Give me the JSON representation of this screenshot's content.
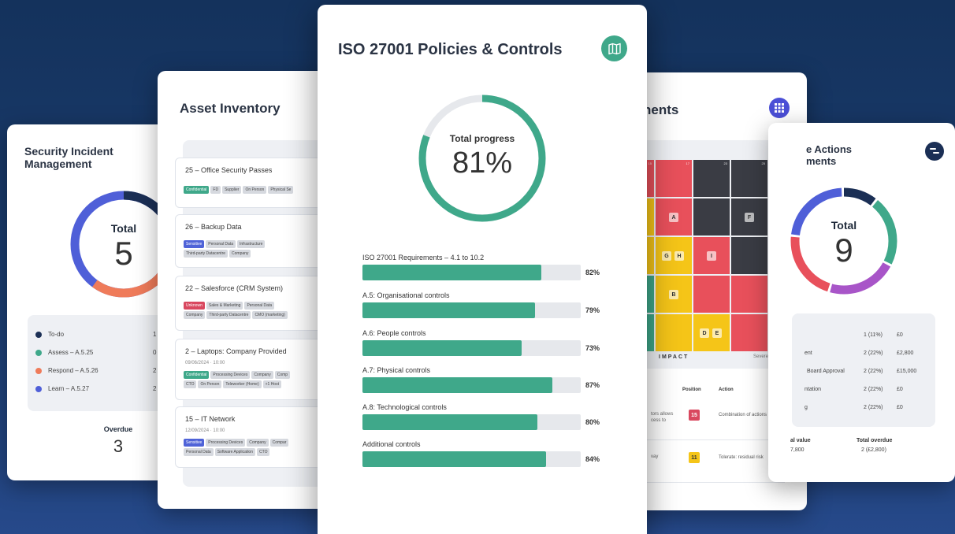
{
  "security_incident": {
    "title": "Security Incident Management",
    "total_label": "Total",
    "total_value": "5",
    "legend": [
      {
        "label": "To-do",
        "count": "1",
        "color": "#1b2f55"
      },
      {
        "label": "Assess – A.5.25",
        "count": "0",
        "color": "#3fa88a"
      },
      {
        "label": "Respond – A.5.26",
        "count": "2",
        "color": "#ef7b5a"
      },
      {
        "label": "Learn – A.5.27",
        "count": "2",
        "color": "#4f5fd8"
      }
    ],
    "overdue_label": "Overdue",
    "overdue_value": "3"
  },
  "asset_inventory": {
    "title": "Asset Inventory",
    "items": [
      {
        "name": "25 – Office Security Passes",
        "date": "",
        "tags": [
          [
            "Confidential",
            "green"
          ],
          [
            "FD",
            ""
          ],
          [
            "Supplier",
            ""
          ],
          [
            "On Person",
            ""
          ],
          [
            "Physical Se",
            ""
          ]
        ]
      },
      {
        "name": "26 – Backup Data",
        "date": "",
        "tags": [
          [
            "Sensitive",
            "blue"
          ],
          [
            "Personal Data",
            ""
          ],
          [
            "Infrastructure",
            ""
          ]
        ],
        "tags2": [
          [
            "Third-party Datacentre",
            ""
          ],
          [
            "Company",
            ""
          ]
        ]
      },
      {
        "name": "22 – Salesforce (CRM System)",
        "date": "",
        "tags": [
          [
            "Unknown",
            "red"
          ],
          [
            "Sales & Marketing",
            ""
          ],
          [
            "Personal Data",
            ""
          ]
        ],
        "tags2": [
          [
            "Company",
            ""
          ],
          [
            "Third-party Datacentre",
            ""
          ],
          [
            "CMO (marketing)",
            ""
          ]
        ]
      },
      {
        "name": "2 – Laptops: Company Provided",
        "date": "09/06/2024 · 10:00",
        "tags": [
          [
            "Confidential",
            "green"
          ],
          [
            "Processing Devices",
            ""
          ],
          [
            "Company",
            ""
          ],
          [
            "Comp",
            ""
          ]
        ],
        "tags2": [
          [
            "CTO",
            ""
          ],
          [
            "On Person",
            ""
          ],
          [
            "Teleworker (Home)",
            ""
          ],
          [
            "+1 Host",
            ""
          ]
        ]
      },
      {
        "name": "15 – IT Network",
        "date": "12/09/2024 · 10:00",
        "tags": [
          [
            "Sensitive",
            "blue"
          ],
          [
            "Processing Devices",
            ""
          ],
          [
            "Company",
            ""
          ],
          [
            "Compar",
            ""
          ]
        ],
        "tags2": [
          [
            "Personal Data",
            ""
          ],
          [
            "Software Application",
            ""
          ],
          [
            "CTO",
            ""
          ]
        ]
      }
    ]
  },
  "iso": {
    "title": "ISO 27001 Policies & Controls",
    "icon": "map-icon",
    "progress_label": "Total progress",
    "progress_value": "81%",
    "progress_fraction": 0.81,
    "accent": "#3fa88a",
    "bars": [
      {
        "label": "ISO 27001 Requirements – 4.1 to 10.2",
        "pct": 82,
        "pct_text": "82%"
      },
      {
        "label": "A.5: Organisational controls",
        "pct": 79,
        "pct_text": "79%"
      },
      {
        "label": "A.6: People controls",
        "pct": 73,
        "pct_text": "73%"
      },
      {
        "label": "A.7: Physical controls",
        "pct": 87,
        "pct_text": "87%"
      },
      {
        "label": "A.8: Technological controls",
        "pct": 80,
        "pct_text": "80%"
      },
      {
        "label": "Additional controls",
        "pct": 84,
        "pct_text": "84%"
      }
    ]
  },
  "risk": {
    "title_visible": "nents",
    "icon": "grid-icon",
    "impact_label": "IMPACT",
    "severe_label": "Severe",
    "header_position": "Position",
    "header_action": "Action",
    "rows": [
      {
        "desc": "tors allows\ncess to",
        "position": "15",
        "badge_color": "#d9485f",
        "badge_text_color": "#ffffff",
        "action": "Combination of actions"
      },
      {
        "desc": "vay",
        "position": "11",
        "badge_color": "#f5c518",
        "badge_text_color": "#333333",
        "action": "Tolerate: residual risk"
      }
    ],
    "cells": [
      {
        "col": 0,
        "row": 0,
        "color": "#e8505b",
        "num": "15"
      },
      {
        "col": 1,
        "row": 0,
        "color": "#e8505b",
        "num": "17"
      },
      {
        "col": 2,
        "row": 0,
        "color": "#3a3c44",
        "num": "23"
      },
      {
        "col": 3,
        "row": 0,
        "color": "#3a3c44",
        "num": "25"
      },
      {
        "col": 0,
        "row": 1,
        "color": "#f5c518",
        "num": ""
      },
      {
        "col": 1,
        "row": 1,
        "color": "#e8505b",
        "num": "",
        "letter": "A"
      },
      {
        "col": 2,
        "row": 1,
        "color": "#3a3c44",
        "num": ""
      },
      {
        "col": 3,
        "row": 1,
        "color": "#3a3c44",
        "num": "",
        "letter": "F"
      },
      {
        "col": 0,
        "row": 2,
        "color": "#f5c518",
        "num": ""
      },
      {
        "col": 1,
        "row": 2,
        "color": "#f5c518",
        "num": "",
        "letter": "G",
        "letter2": "H"
      },
      {
        "col": 2,
        "row": 2,
        "color": "#e8505b",
        "num": "",
        "letter": "I"
      },
      {
        "col": 3,
        "row": 2,
        "color": "#3a3c44",
        "num": ""
      },
      {
        "col": 0,
        "row": 3,
        "color": "#3fa88a",
        "num": ""
      },
      {
        "col": 1,
        "row": 3,
        "color": "#f5c518",
        "num": "",
        "letter": "B"
      },
      {
        "col": 2,
        "row": 3,
        "color": "#e8505b",
        "num": ""
      },
      {
        "col": 3,
        "row": 3,
        "color": "#e8505b",
        "num": ""
      },
      {
        "col": 0,
        "row": 4,
        "color": "#3fa88a",
        "num": ""
      },
      {
        "col": 1,
        "row": 4,
        "color": "#f5c518",
        "num": ""
      },
      {
        "col": 2,
        "row": 4,
        "color": "#f5c518",
        "num": "",
        "letter": "D",
        "letter2": "E"
      },
      {
        "col": 3,
        "row": 4,
        "color": "#e8505b",
        "num": ""
      }
    ]
  },
  "actions": {
    "title_line1": "e Actions",
    "title_line2": "ments",
    "icon": "toggle-icon",
    "total_label": "Total",
    "total_value": "9",
    "rows": [
      {
        "name": "",
        "count": "1 (11%)",
        "value": "£0"
      },
      {
        "name": "ent",
        "count": "2 (22%)",
        "value": "£2,800"
      },
      {
        "name": "Board Approval",
        "count": "2 (22%)",
        "value": "£15,000"
      },
      {
        "name": "ntation",
        "count": "2 (22%)",
        "value": "£0"
      },
      {
        "name": "g",
        "count": "2 (22%)",
        "value": "£0"
      }
    ],
    "foot_value_label": "al value",
    "foot_value": "7,800",
    "foot_overdue_label": "Total overdue",
    "foot_overdue": "2 (£2,800)",
    "segments": [
      {
        "color": "#1b2f55",
        "fraction": 0.11
      },
      {
        "color": "#3fa88a",
        "fraction": 0.22
      },
      {
        "color": "#a855c8",
        "fraction": 0.22
      },
      {
        "color": "#e8505b",
        "fraction": 0.22
      },
      {
        "color": "#4f5fd8",
        "fraction": 0.23
      }
    ]
  }
}
